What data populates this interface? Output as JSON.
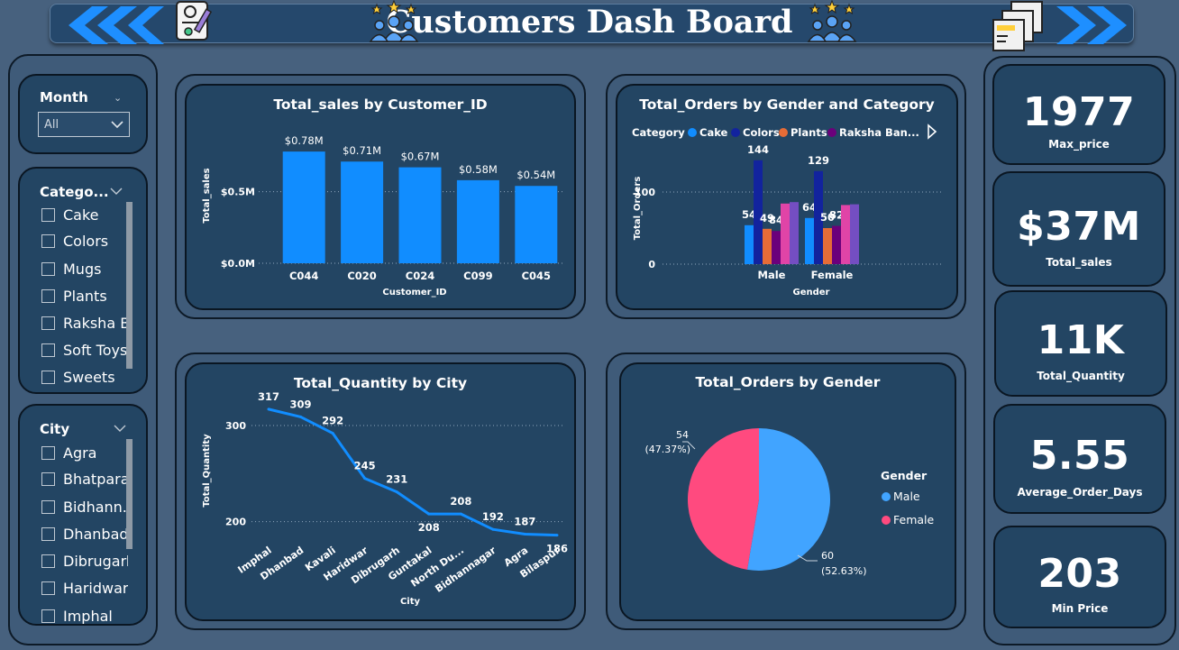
{
  "header": {
    "title": "Customers Dash Board"
  },
  "filters": {
    "month": {
      "title": "Month",
      "selected": "All"
    },
    "category": {
      "title": "Catego...",
      "items": [
        "Cake",
        "Colors",
        "Mugs",
        "Plants",
        "Raksha B...",
        "Soft Toys",
        "Sweets"
      ]
    },
    "city": {
      "title": "City",
      "items": [
        "Agra",
        "Bhatpara",
        "Bidhann...",
        "Dhanbad",
        "Dibrugarh",
        "Haridwar",
        "Imphal"
      ]
    }
  },
  "kpis": [
    {
      "value": "1977",
      "label": "Max_price"
    },
    {
      "value": "$37M",
      "label": "Total_sales"
    },
    {
      "value": "11K",
      "label": "Total_Quantity"
    },
    {
      "value": "5.55",
      "label": "Average_Order_Days"
    },
    {
      "value": "203",
      "label": "Min Price"
    }
  ],
  "colors": {
    "bar": "#118dff",
    "cake": "#118dff",
    "colors": "#12239e",
    "plants": "#e66c37",
    "raksha": "#6b007b",
    "c5": "#e044a7",
    "c6": "#744ec2",
    "male": "#41a4ff",
    "female": "#ff4a7f",
    "line": "#118dff"
  },
  "chart_data": [
    {
      "type": "bar",
      "title": "Total_sales by Customer_ID",
      "xlabel": "Customer_ID",
      "ylabel": "Total_sales",
      "categories": [
        "C044",
        "C020",
        "C024",
        "C099",
        "C045"
      ],
      "values": [
        0.78,
        0.71,
        0.67,
        0.58,
        0.54
      ],
      "labels": [
        "$0.78M",
        "$0.71M",
        "$0.67M",
        "$0.58M",
        "$0.54M"
      ],
      "ticks": [
        "$0.0M",
        "$0.5M"
      ],
      "ylim": [
        0,
        0.85
      ],
      "grid": true
    },
    {
      "type": "bar",
      "title": "Total_Orders by Gender and Category",
      "xlabel": "Gender",
      "ylabel": "Total_Orders",
      "legend_title": "Category",
      "legend": [
        "Cake",
        "Colors",
        "Plants",
        "Raksha Ban..."
      ],
      "categories": [
        "Male",
        "Female"
      ],
      "series": [
        {
          "name": "Cake",
          "values": [
            54,
            64
          ]
        },
        {
          "name": "Colors",
          "values": [
            144,
            129
          ]
        },
        {
          "name": "Plants",
          "values": [
            49,
            50
          ]
        },
        {
          "name": "Raksha Bandhan",
          "values": [
            46,
            53
          ]
        },
        {
          "values": [
            84,
            82
          ]
        },
        {
          "values": [
            86,
            83
          ]
        }
      ],
      "shown_labels": [
        [
          "54",
          "144",
          "49",
          "84"
        ],
        [
          "64",
          "129",
          "50",
          "82"
        ]
      ],
      "ticks": [
        "0",
        "100"
      ],
      "ylim": [
        0,
        160
      ],
      "grid": true
    },
    {
      "type": "line",
      "title": "Total_Quantity by City",
      "xlabel": "City",
      "ylabel": "Total_Quantity",
      "categories": [
        "Imphal",
        "Dhanbad",
        "Kavali",
        "Haridwar",
        "Dibrugarh",
        "Guntakal",
        "North Du...",
        "Bidhannagar",
        "Agra",
        "Bilaspur"
      ],
      "values": [
        317,
        309,
        292,
        245,
        231,
        208,
        208,
        192,
        187,
        186
      ],
      "ticks": [
        "200",
        "300"
      ],
      "ylim": [
        180,
        330
      ],
      "grid": true
    },
    {
      "type": "pie",
      "title": "Total_Orders by Gender",
      "legend_title": "Gender",
      "slices": [
        {
          "name": "Male",
          "value": 60,
          "pct": "(52.63%)"
        },
        {
          "name": "Female",
          "value": 54,
          "pct": "(47.37%)"
        }
      ]
    }
  ]
}
